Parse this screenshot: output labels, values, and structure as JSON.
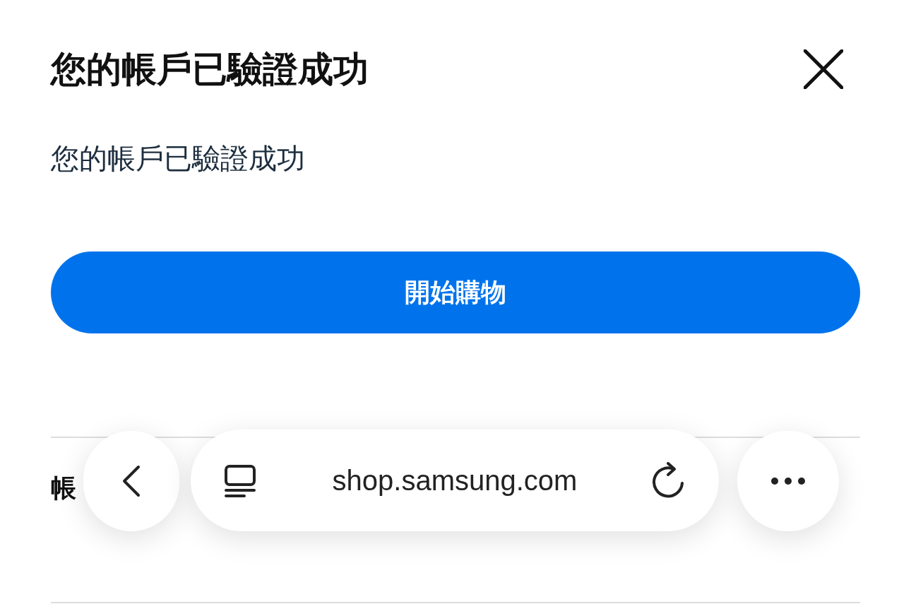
{
  "dialog": {
    "title": "您的帳戶已驗證成功",
    "message": "您的帳戶已驗證成功",
    "button": "開始購物",
    "section_heading": "帳"
  },
  "browser_toolbar": {
    "url": "shop.samsung.com"
  }
}
